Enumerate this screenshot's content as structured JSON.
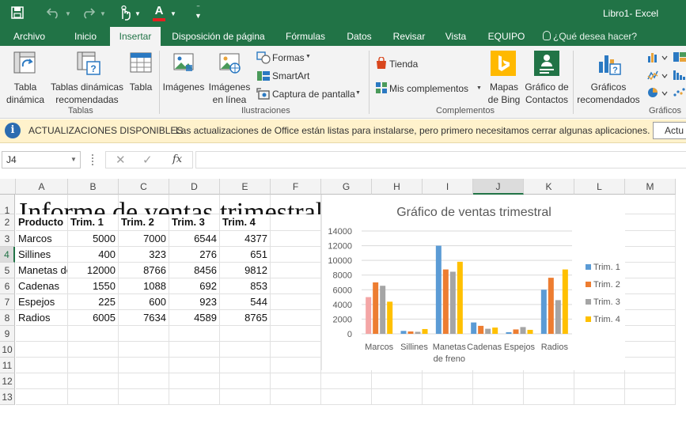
{
  "window": {
    "title": "Libro1- Excel",
    "font_color_letter": "A"
  },
  "tabs": [
    {
      "label": "Archivo"
    },
    {
      "label": "Inicio"
    },
    {
      "label": "Insertar",
      "active": true
    },
    {
      "label": "Disposición de página"
    },
    {
      "label": "Fórmulas"
    },
    {
      "label": "Datos"
    },
    {
      "label": "Revisar"
    },
    {
      "label": "Vista"
    },
    {
      "label": "EQUIPO"
    }
  ],
  "tell_me": {
    "placeholder": "¿Qué desea hacer?"
  },
  "ribbon": {
    "tabla_dinamica": [
      "Tabla",
      "dinámica"
    ],
    "tablas_recomendadas": [
      "Tablas dinámicas",
      "recomendadas"
    ],
    "tabla": "Tabla",
    "imagenes": "Imágenes",
    "imagenes_linea": [
      "Imágenes",
      "en línea"
    ],
    "formas": "Formas",
    "smartart": "SmartArt",
    "captura": "Captura de pantalla",
    "tienda": "Tienda",
    "mis_complementos": "Mis complementos",
    "bing": [
      "Mapas",
      "de Bing"
    ],
    "contactos": [
      "Gráfico de",
      "Contactos"
    ],
    "graficos_recomendados": [
      "Gráficos",
      "recomendados"
    ],
    "groups": {
      "tablas": "Tablas",
      "ilustraciones": "Ilustraciones",
      "complementos": "Complementos",
      "graficos": "Gráficos"
    }
  },
  "infobar": {
    "title": "ACTUALIZACIONES DISPONIBLES",
    "message": "Las actualizaciones de Office están listas para instalarse, pero primero necesitamos cerrar algunas aplicaciones.",
    "button": "Actu"
  },
  "formula_bar": {
    "name_box": "J4",
    "fx": "fx",
    "value": ""
  },
  "columns": [
    "A",
    "B",
    "C",
    "D",
    "E",
    "F",
    "G",
    "H",
    "I",
    "J",
    "K",
    "L",
    "M"
  ],
  "rows": [
    "1",
    "2",
    "3",
    "4",
    "5",
    "6",
    "7",
    "8",
    "9",
    "10",
    "11",
    "12",
    "13"
  ],
  "sheet": {
    "title": "Informe de ventas trimestral",
    "headers": [
      "Producto",
      "Trim. 1",
      "Trim. 2",
      "Trim. 3",
      "Trim. 4"
    ],
    "data": [
      [
        "Marcos",
        "5000",
        "7000",
        "6544",
        "4377"
      ],
      [
        "Sillines",
        "400",
        "323",
        "276",
        "651"
      ],
      [
        "Manetas de freno",
        "12000",
        "8766",
        "8456",
        "9812"
      ],
      [
        "Cadenas",
        "1550",
        "1088",
        "692",
        "853"
      ],
      [
        "Espejos",
        "225",
        "600",
        "923",
        "544"
      ],
      [
        "Radios",
        "6005",
        "7634",
        "4589",
        "8765"
      ]
    ]
  },
  "chart_data": {
    "type": "bar",
    "title": "Gráfico de ventas trimestral",
    "categories": [
      "Marcos",
      "Sillines",
      "Manetas de freno",
      "Cadenas",
      "Espejos",
      "Radios"
    ],
    "category_lines": [
      [
        "Marcos"
      ],
      [
        "Sillines"
      ],
      [
        "Manetas",
        "de freno"
      ],
      [
        "Cadenas"
      ],
      [
        "Espejos"
      ],
      [
        "Radios"
      ]
    ],
    "series": [
      {
        "name": "Trim. 1",
        "values": [
          5000,
          400,
          12000,
          1550,
          225,
          6005
        ],
        "color": "#5b9bd5"
      },
      {
        "name": "Trim. 2",
        "values": [
          7000,
          323,
          8766,
          1088,
          600,
          7634
        ],
        "color": "#ed7d31"
      },
      {
        "name": "Trim. 3",
        "values": [
          6544,
          276,
          8456,
          692,
          923,
          4589
        ],
        "color": "#a5a5a5"
      },
      {
        "name": "Trim. 4",
        "values": [
          4377,
          651,
          9812,
          853,
          544,
          8765
        ],
        "color": "#ffc000"
      }
    ],
    "highlight": {
      "category": 0,
      "series": 0,
      "color": "#f4a6a6"
    },
    "ylim": [
      0,
      14000
    ],
    "yticks": [
      0,
      2000,
      4000,
      6000,
      8000,
      10000,
      12000,
      14000
    ],
    "grid": true,
    "legend": "right"
  },
  "colors": {
    "accent": "#217346",
    "infobar": "#fff2cc"
  }
}
